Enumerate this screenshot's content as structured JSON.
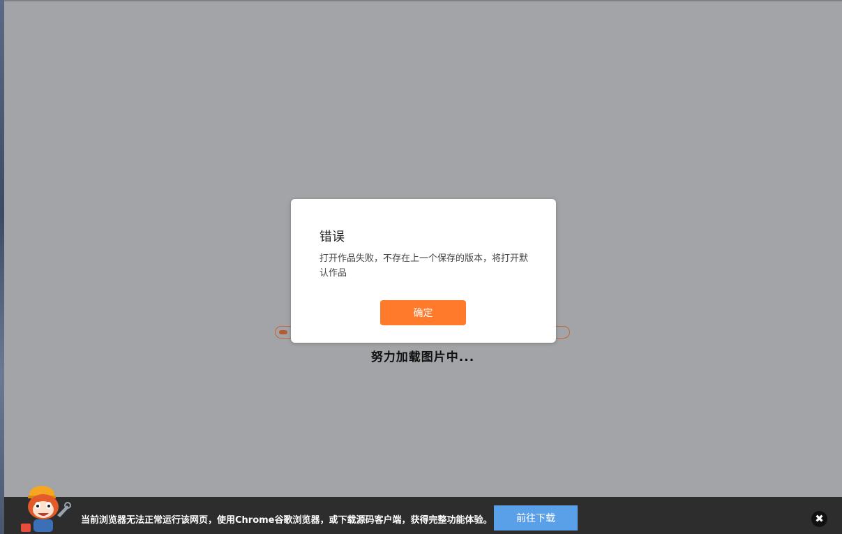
{
  "loading": {
    "text": "努力加载图片中...",
    "progress": 0.03
  },
  "dialog": {
    "title": "错误",
    "message": "打开作品失败，不存在上一个保存的版本，将打开默认作品",
    "confirm_label": "确定"
  },
  "banner": {
    "message": "当前浏览器无法正常运行该网页，使用Chrome谷歌浏览器，或下载源码客户端，获得完整功能体验。",
    "download_label": "前往下载",
    "close_glyph": "✖"
  },
  "colors": {
    "accent": "#ff7a2a",
    "download": "#5aa0e8",
    "overlay": "#a3a4a7",
    "bar": "#2d2d2d"
  },
  "icons": {
    "mascot": "fox-mascot-icon",
    "close": "close-icon"
  }
}
